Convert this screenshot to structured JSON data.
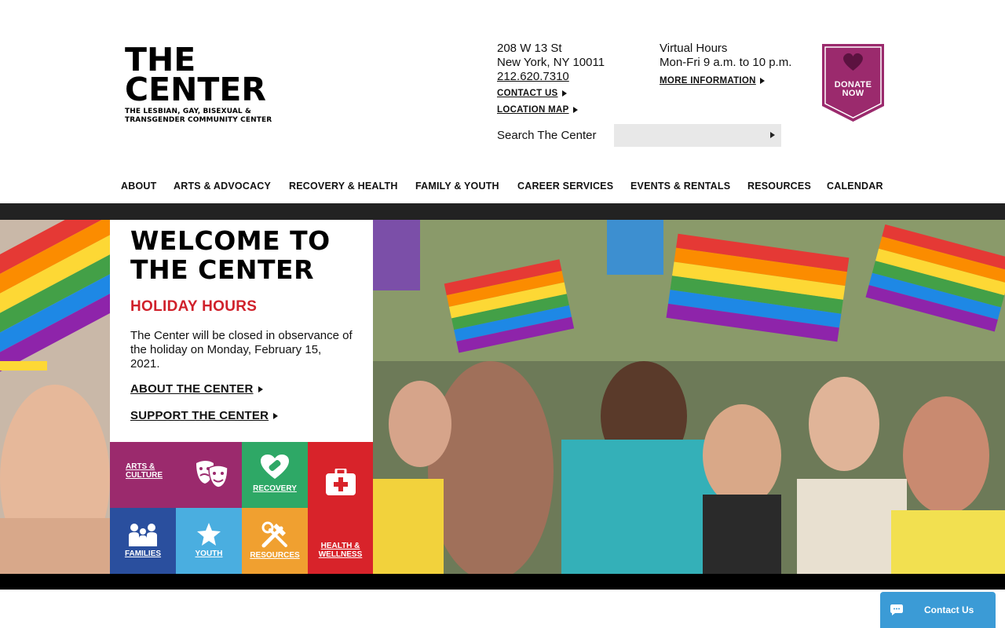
{
  "logo": {
    "line1": "THE",
    "line2": "CENTER",
    "sub1": "THE LESBIAN, GAY, BISEXUAL &",
    "sub2": "TRANSGENDER COMMUNITY CENTER"
  },
  "address": {
    "street": "208 W 13 St",
    "city": "New York, NY 10011",
    "phone": "212.620.7310",
    "contact_link": "CONTACT US",
    "map_link": "LOCATION MAP"
  },
  "hours": {
    "title": "Virtual Hours",
    "times": "Mon-Fri 9 a.m. to 10 p.m.",
    "more_link": "MORE INFORMATION"
  },
  "donate": {
    "line1": "DONATE",
    "line2": "NOW",
    "color": "#9b2a6d"
  },
  "search": {
    "label": "Search The Center",
    "placeholder": ""
  },
  "nav": [
    "ABOUT",
    "ARTS & ADVOCACY",
    "RECOVERY & HEALTH",
    "FAMILY & YOUTH",
    "CAREER SERVICES",
    "EVENTS & RENTALS",
    "RESOURCES",
    "CALENDAR"
  ],
  "welcome": {
    "title1": "WELCOME TO",
    "title2": "THE CENTER",
    "subtitle": "HOLIDAY HOURS",
    "body": "The Center will be closed in observance of the holiday on Monday, February 15, 2021.",
    "about_link": "ABOUT THE CENTER",
    "support_link": "SUPPORT THE CENTER"
  },
  "tiles": {
    "arts": {
      "line1": "ARTS &",
      "line2": "CULTURE",
      "color": "#9b2a6d",
      "icon": "theater-masks-icon"
    },
    "recovery": {
      "label": "RECOVERY",
      "color": "#2ea866",
      "icon": "heart-bandage-icon"
    },
    "health": {
      "line1": "HEALTH &",
      "line2": "WELLNESS",
      "color": "#d8232a",
      "icon": "first-aid-kit-icon"
    },
    "families": {
      "label": "FAMILIES",
      "color": "#2a4f9e",
      "icon": "family-icon"
    },
    "youth": {
      "label": "YOUTH",
      "color": "#4aaee0",
      "icon": "star-icon"
    },
    "resources": {
      "label": "RESOURCES",
      "color": "#f0a030",
      "icon": "tools-icon"
    }
  },
  "chat": {
    "label": "Contact Us",
    "color": "#3b9bd6"
  }
}
